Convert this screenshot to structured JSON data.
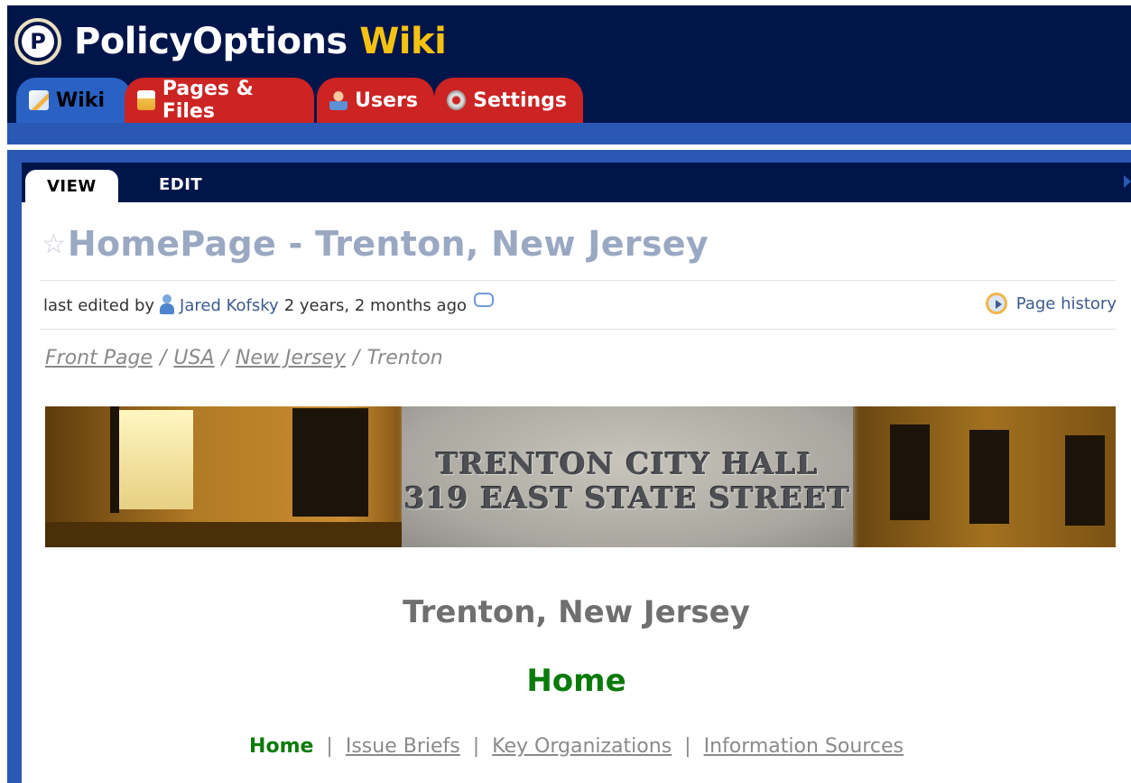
{
  "brand": {
    "name": "PolicyOptions",
    "suffix": "Wiki",
    "logo_letter": "P",
    "colors": {
      "navy": "#00154a",
      "gold": "#f5c211",
      "red_tab": "#cc2323",
      "blue_bar": "#2a58b4"
    }
  },
  "main_tabs": [
    {
      "label": "Wiki",
      "icon": "pencil-page-icon",
      "active": true
    },
    {
      "label": "Pages & Files",
      "icon": "folder-pages-icon",
      "active": false
    },
    {
      "label": "Users",
      "icon": "user-icon",
      "active": false
    },
    {
      "label": "Settings",
      "icon": "gear-icon",
      "active": false
    }
  ],
  "sub_tabs": [
    {
      "label": "VIEW",
      "active": true
    },
    {
      "label": "EDIT",
      "active": false
    }
  ],
  "page": {
    "title": "HomePage - Trenton, New Jersey",
    "meta_prefix": "last edited by",
    "author": "Jared Kofsky",
    "edited_ago": "2 years, 2 months ago",
    "history_label": "Page history",
    "breadcrumb": [
      {
        "label": "Front Page",
        "link": true
      },
      {
        "label": "USA",
        "link": true
      },
      {
        "label": "New Jersey",
        "link": true
      },
      {
        "label": "Trenton",
        "link": false
      }
    ],
    "breadcrumb_separator": "/",
    "banner_text_line1": "TRENTON CITY HALL",
    "banner_text_line2": "319 EAST STATE STREET",
    "city_heading": "Trenton, New Jersey",
    "section_heading": "Home",
    "subnav": [
      {
        "label": "Home",
        "current": true
      },
      {
        "label": "Issue Briefs",
        "current": false
      },
      {
        "label": "Key Organizations",
        "current": false
      },
      {
        "label": "Information Sources",
        "current": false
      }
    ],
    "subnav_separator": "|"
  }
}
